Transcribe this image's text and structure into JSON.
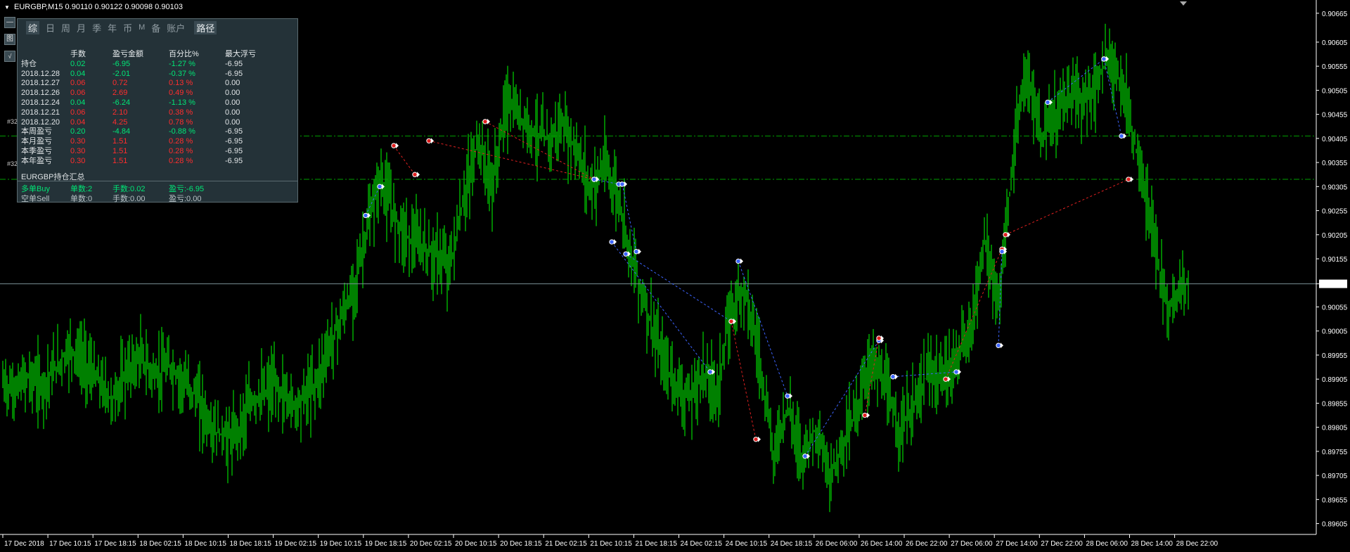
{
  "header": {
    "symbol_line": "EURGBP,M15  0.90110 0.90122 0.90098 0.90103"
  },
  "panel": {
    "tabs": [
      "综",
      "日",
      "周",
      "月",
      "季",
      "年",
      "币",
      "M",
      "备",
      "账户"
    ],
    "path_tab": "路径",
    "columns": [
      "",
      "手数",
      "盈亏金额",
      "百分比%",
      "最大浮亏"
    ],
    "rows": [
      {
        "label": "持仓",
        "lots": "0.02",
        "pnl": "-6.95",
        "pct": "-1.27 %",
        "maxdd": "-6.95",
        "color": "pos"
      },
      {
        "label": "2018.12.28",
        "lots": "0.04",
        "pnl": "-2.01",
        "pct": "-0.37 %",
        "maxdd": "-6.95",
        "color": "pos"
      },
      {
        "label": "2018.12.27",
        "lots": "0.06",
        "pnl": "0.72",
        "pct": "0.13 %",
        "maxdd": "0.00",
        "color": "neg"
      },
      {
        "label": "2018.12.26",
        "lots": "0.06",
        "pnl": "2.69",
        "pct": "0.49 %",
        "maxdd": "0.00",
        "color": "neg"
      },
      {
        "label": "2018.12.24",
        "lots": "0.04",
        "pnl": "-6.24",
        "pct": "-1.13 %",
        "maxdd": "0.00",
        "color": "pos"
      },
      {
        "label": "2018.12.21",
        "lots": "0.06",
        "pnl": "2.10",
        "pct": "0.38 %",
        "maxdd": "0.00",
        "color": "neg"
      },
      {
        "label": "2018.12.20",
        "lots": "0.04",
        "pnl": "4.25",
        "pct": "0.78 %",
        "maxdd": "0.00",
        "color": "neg"
      },
      {
        "label": "本周盈亏",
        "lots": "0.20",
        "pnl": "-4.84",
        "pct": "-0.88 %",
        "maxdd": "-6.95",
        "color": "pos"
      },
      {
        "label": "本月盈亏",
        "lots": "0.30",
        "pnl": "1.51",
        "pct": "0.28 %",
        "maxdd": "-6.95",
        "color": "neg"
      },
      {
        "label": "本季盈亏",
        "lots": "0.30",
        "pnl": "1.51",
        "pct": "0.28 %",
        "maxdd": "-6.95",
        "color": "neg"
      },
      {
        "label": "本年盈亏",
        "lots": "0.30",
        "pnl": "1.51",
        "pct": "0.28 %",
        "maxdd": "-6.95",
        "color": "neg"
      }
    ],
    "summary_title": "EURGBP持仓汇总",
    "buy": {
      "label": "多单Buy",
      "count": "单数:2",
      "lots": "手数:0.02",
      "pnl": "盈亏:-6.95"
    },
    "sell": {
      "label": "空单Sell",
      "count": "单数:0",
      "lots": "手数:0.00",
      "pnl": "盈亏:0.00"
    }
  },
  "side_labels": [
    "#32",
    "#32"
  ],
  "left_buttons": [
    "—",
    "图",
    "√"
  ],
  "colors": {
    "candle": "#00a000",
    "buy_line": "#3c64ff",
    "sell_line": "#e02020",
    "hline": "#00a000",
    "price_line": "#7a8f95"
  },
  "chart_data": {
    "type": "candlestick",
    "symbol": "EURGBP",
    "timeframe": "M15",
    "current_price": "0.90103",
    "ylim": [
      0.896,
      0.90675
    ],
    "y_ticks": [
      "0.90665",
      "0.90605",
      "0.90555",
      "0.90505",
      "0.90455",
      "0.90405",
      "0.90355",
      "0.90305",
      "0.90255",
      "0.90205",
      "0.90155",
      "0.90103",
      "0.90055",
      "0.90005",
      "0.89955",
      "0.89905",
      "0.89855",
      "0.89805",
      "0.89755",
      "0.89705",
      "0.89655",
      "0.89605"
    ],
    "x_ticks": [
      "17 Dec 2018",
      "17 Dec 10:15",
      "17 Dec 18:15",
      "18 Dec 02:15",
      "18 Dec 10:15",
      "18 Dec 18:15",
      "19 Dec 02:15",
      "19 Dec 10:15",
      "19 Dec 18:15",
      "20 Dec 02:15",
      "20 Dec 10:15",
      "20 Dec 18:15",
      "21 Dec 02:15",
      "21 Dec 10:15",
      "21 Dec 18:15",
      "24 Dec 02:15",
      "24 Dec 10:15",
      "24 Dec 18:15",
      "26 Dec 06:00",
      "26 Dec 14:00",
      "26 Dec 22:00",
      "27 Dec 06:00",
      "27 Dec 14:00",
      "27 Dec 22:00",
      "28 Dec 06:00",
      "28 Dec 14:00",
      "28 Dec 22:00"
    ],
    "horizontal_lines": [
      0.9041,
      0.9032
    ],
    "close_path": [
      [
        0,
        0.899
      ],
      [
        20,
        0.8988
      ],
      [
        40,
        0.8991
      ],
      [
        60,
        0.8989
      ],
      [
        80,
        0.8993
      ],
      [
        100,
        0.8997
      ],
      [
        120,
        0.8994
      ],
      [
        140,
        0.899
      ],
      [
        160,
        0.8986
      ],
      [
        180,
        0.8992
      ],
      [
        200,
        0.8995
      ],
      [
        220,
        0.8991
      ],
      [
        240,
        0.8993
      ],
      [
        260,
        0.899
      ],
      [
        280,
        0.8987
      ],
      [
        300,
        0.898
      ],
      [
        330,
        0.8978
      ],
      [
        360,
        0.8986
      ],
      [
        390,
        0.8989
      ],
      [
        420,
        0.8985
      ],
      [
        450,
        0.899
      ],
      [
        470,
        0.8998
      ],
      [
        500,
        0.9008
      ],
      [
        520,
        0.902
      ],
      [
        540,
        0.9032
      ],
      [
        560,
        0.9025
      ],
      [
        580,
        0.902
      ],
      [
        600,
        0.9018
      ],
      [
        620,
        0.9016
      ],
      [
        640,
        0.9014
      ],
      [
        660,
        0.9028
      ],
      [
        680,
        0.904
      ],
      [
        700,
        0.903
      ],
      [
        720,
        0.9048
      ],
      [
        740,
        0.9045
      ],
      [
        760,
        0.9042
      ],
      [
        780,
        0.904
      ],
      [
        800,
        0.9043
      ],
      [
        820,
        0.9038
      ],
      [
        840,
        0.903
      ],
      [
        860,
        0.9035
      ],
      [
        880,
        0.9028
      ],
      [
        900,
        0.9015
      ],
      [
        920,
        0.9005
      ],
      [
        940,
        0.8995
      ],
      [
        960,
        0.899
      ],
      [
        980,
        0.8986
      ],
      [
        1000,
        0.8992
      ],
      [
        1020,
        0.8988
      ],
      [
        1040,
        0.9005
      ],
      [
        1060,
        0.901
      ],
      [
        1080,
        0.8995
      ],
      [
        1100,
        0.8975
      ],
      [
        1120,
        0.8985
      ],
      [
        1140,
        0.8975
      ],
      [
        1160,
        0.898
      ],
      [
        1180,
        0.897
      ],
      [
        1200,
        0.8978
      ],
      [
        1220,
        0.8985
      ],
      [
        1240,
        0.8995
      ],
      [
        1260,
        0.8988
      ],
      [
        1280,
        0.898
      ],
      [
        1300,
        0.8985
      ],
      [
        1320,
        0.8992
      ],
      [
        1340,
        0.899
      ],
      [
        1360,
        0.8995
      ],
      [
        1380,
        0.9
      ],
      [
        1400,
        0.902
      ],
      [
        1420,
        0.9005
      ],
      [
        1440,
        0.9035
      ],
      [
        1460,
        0.9055
      ],
      [
        1480,
        0.904
      ],
      [
        1500,
        0.9045
      ],
      [
        1520,
        0.905
      ],
      [
        1540,
        0.9048
      ],
      [
        1560,
        0.9052
      ],
      [
        1580,
        0.9058
      ],
      [
        1600,
        0.905
      ],
      [
        1620,
        0.9035
      ],
      [
        1640,
        0.902
      ],
      [
        1660,
        0.9005
      ],
      [
        1680,
        0.901
      ],
      [
        1690,
        0.90103
      ]
    ],
    "trade_links": [
      {
        "from": [
          520,
          0.90245
        ],
        "to": [
          540,
          0.90305
        ],
        "color": "buy"
      },
      {
        "from": [
          560,
          0.9039
        ],
        "to": [
          590,
          0.9033
        ],
        "color": "sell"
      },
      {
        "from": [
          610,
          0.904
        ],
        "to": [
          845,
          0.9032
        ],
        "color": "sell"
      },
      {
        "from": [
          690,
          0.9044
        ],
        "to": [
          845,
          0.9032
        ],
        "color": "sell"
      },
      {
        "from": [
          845,
          0.9032
        ],
        "to": [
          880,
          0.9031
        ],
        "color": "buy"
      },
      {
        "from": [
          885,
          0.9031
        ],
        "to": [
          905,
          0.9017
        ],
        "color": "buy"
      },
      {
        "from": [
          890,
          0.90165
        ],
        "to": [
          1040,
          0.90025
        ],
        "color": "buy"
      },
      {
        "from": [
          870,
          0.9019
        ],
        "to": [
          1010,
          0.8992
        ],
        "color": "buy"
      },
      {
        "from": [
          1040,
          0.90025
        ],
        "to": [
          1075,
          0.8978
        ],
        "color": "sell"
      },
      {
        "from": [
          1050,
          0.9015
        ],
        "to": [
          1120,
          0.8987
        ],
        "color": "buy"
      },
      {
        "from": [
          1145,
          0.89745
        ],
        "to": [
          1250,
          0.89985
        ],
        "color": "buy"
      },
      {
        "from": [
          1230,
          0.8983
        ],
        "to": [
          1250,
          0.8999
        ],
        "color": "sell"
      },
      {
        "from": [
          1270,
          0.8991
        ],
        "to": [
          1360,
          0.8992
        ],
        "color": "buy"
      },
      {
        "from": [
          1345,
          0.89905
        ],
        "to": [
          1425,
          0.90175
        ],
        "color": "sell"
      },
      {
        "from": [
          1420,
          0.89975
        ],
        "to": [
          1425,
          0.9017
        ],
        "color": "buy"
      },
      {
        "from": [
          1430,
          0.90205
        ],
        "to": [
          1605,
          0.9032
        ],
        "color": "sell"
      },
      {
        "from": [
          1490,
          0.9048
        ],
        "to": [
          1570,
          0.9057
        ],
        "color": "buy"
      },
      {
        "from": [
          1570,
          0.9057
        ],
        "to": [
          1595,
          0.9041
        ],
        "color": "buy"
      }
    ]
  }
}
